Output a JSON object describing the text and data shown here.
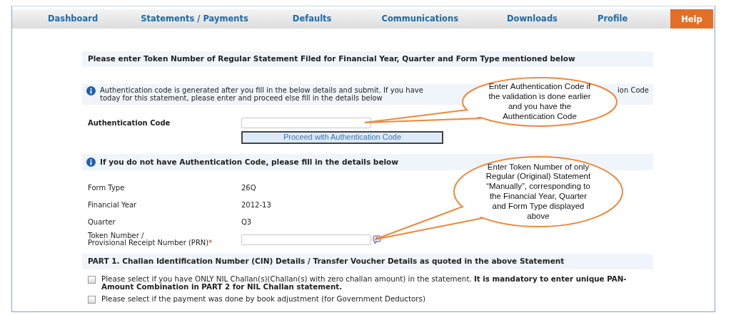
{
  "nav": [
    {
      "label": "Dashboard"
    },
    {
      "label": "Statements / Payments"
    },
    {
      "label": "Defaults"
    },
    {
      "label": "Communications"
    },
    {
      "label": "Downloads"
    },
    {
      "label": "Profile"
    }
  ],
  "help": "Help",
  "heading": "Please enter Token Number of Regular Statement Filed for Financial Year, Quarter and Form Type mentioned below",
  "auth_info": {
    "line1_start": "Authentication code is generated after you fill in the below details and submit. If you have",
    "line1_end": "ion Code",
    "line2": "today for this statement, please enter and proceed else fill in the details below"
  },
  "auth_field": {
    "label": "Authentication Code"
  },
  "proceed_button": "Proceed with Authentication Code",
  "fill_info": "If you do not have Authentication Code, please fill in the details below",
  "details": [
    {
      "label": "Form Type",
      "value": "26Q"
    },
    {
      "label": "Financial Year",
      "value": "2012-13"
    },
    {
      "label": "Quarter",
      "value": "Q3"
    }
  ],
  "token_field": {
    "label_lines": [
      "Token Number /",
      "Provisional Receipt Number (PRN)"
    ],
    "required_mark": "*"
  },
  "part1": {
    "heading": "PART 1. Challan Identification Number (CIN) Details / Transfer Voucher Details as quoted in the above Statement",
    "options": [
      {
        "text": "Please select if you have ONLY NIL Challan(s)(Challan(s) with zero challan amount) in the statement. **It is mandatory to enter unique PAN-Amount Combination in PART 2 for NIL Challan statement.**",
        "checked": false
      },
      {
        "text": "Please select if the payment was done by book adjustment (for Government Deductors)",
        "checked": false
      }
    ]
  },
  "callouts": [
    {
      "lines": [
        "Enter Authentication Code if",
        "the validation is done earlier",
        "and you have the",
        "Authentication Code"
      ]
    },
    {
      "lines": [
        "Enter Token Number of only",
        "Regular (Original) Statement",
        "“Manually”, corresponding to",
        "the Financial Year, Quarter",
        "and Form Type displayed",
        "above"
      ]
    }
  ]
}
